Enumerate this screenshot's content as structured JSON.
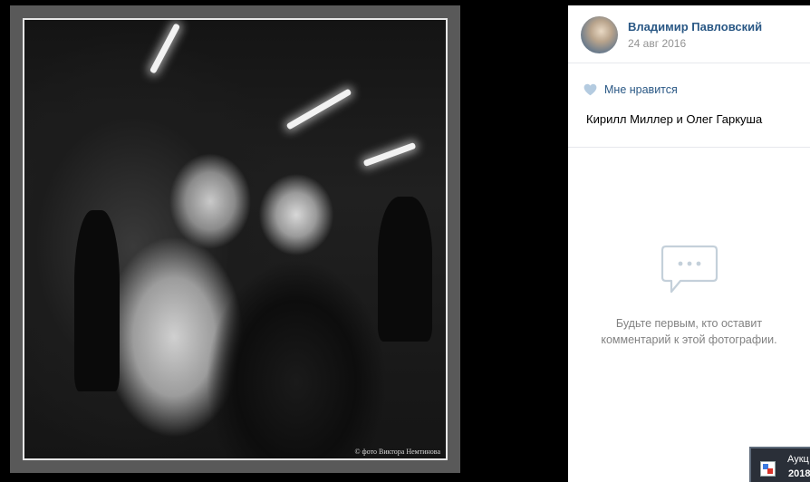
{
  "post": {
    "author_name": "Владимир Павловский",
    "date": "24 авг 2016",
    "like_label": "Мне нравится",
    "caption": "Кирилл Миллер и Олег Гаркуша"
  },
  "photo": {
    "watermark": "© фото Виктора Немтинова"
  },
  "comments": {
    "empty_line1": "Будьте первым, кто оставит",
    "empty_line2": "комментарий к этой фотографии."
  },
  "taskbar": {
    "title": "Аукц",
    "year": "2018"
  },
  "colors": {
    "link": "#2a5885",
    "muted": "#939393",
    "like_heart": "#b4cbe0",
    "icon_gray": "#c4d0da"
  }
}
